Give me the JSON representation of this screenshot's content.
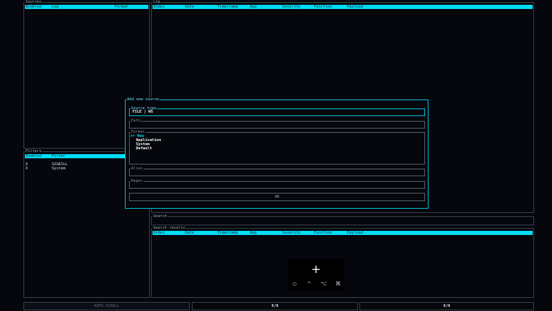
{
  "sources": {
    "title": "Sources",
    "columns": [
      "Enabled",
      "Log",
      "Format"
    ]
  },
  "log": {
    "title": "Log",
    "columns": [
      "Index",
      "Date",
      "Timestamp",
      "App",
      "Severity",
      "Function",
      "Payload"
    ]
  },
  "filters": {
    "title": "Filters",
    "columns": [
      "Enabled",
      "Filter"
    ],
    "rows": [
      {
        "enabled": "X",
        "filter": "SIGKILL"
      },
      {
        "enabled": "X",
        "filter": "System"
      }
    ]
  },
  "search": {
    "title": "Search",
    "value": ""
  },
  "search_results": {
    "title": "Search results",
    "columns": [
      "Index",
      "Date",
      "Timestamp",
      "App",
      "Severity",
      "Function",
      "Payload"
    ]
  },
  "status_bar": {
    "auto_scroll": "AUTO SCROLL",
    "counter_left": "0/0",
    "counter_right": "0/0"
  },
  "modal": {
    "title": "Add new source",
    "source_type": {
      "label": "Source type",
      "options_text": "FILE | WS"
    },
    "path": {
      "label": "Path",
      "value": ""
    },
    "format": {
      "label": "Format",
      "selected": ">> New",
      "options": [
        "Application",
        "System",
        "Default"
      ]
    },
    "alias": {
      "label": "Alias",
      "value": ""
    },
    "regex": {
      "label": "Regex",
      "value": ""
    },
    "ok_label": "OK"
  },
  "keyboard_overlay": {
    "primary": "+",
    "modifiers": [
      "◇",
      "^",
      "⌥",
      "⌘"
    ]
  },
  "colors": {
    "background": "#05070d",
    "accent": "#00dcf5",
    "border": "#3b4250",
    "text": "#c8d2dc"
  }
}
